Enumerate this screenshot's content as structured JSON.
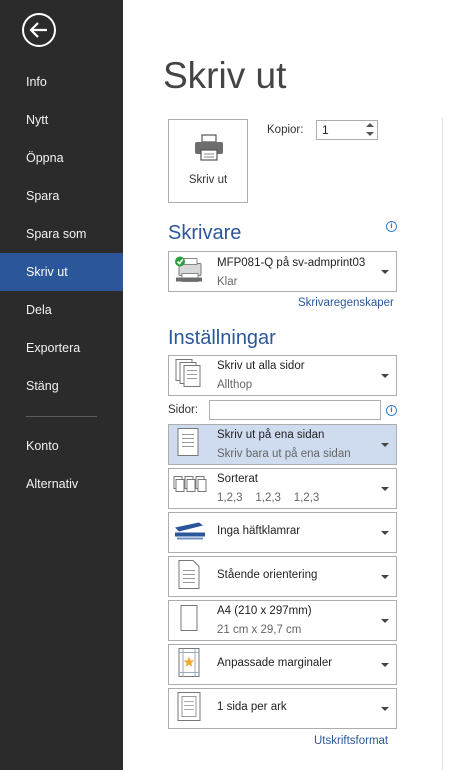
{
  "sidebar": {
    "items": [
      {
        "label": "Info"
      },
      {
        "label": "Nytt"
      },
      {
        "label": "Öppna"
      },
      {
        "label": "Spara"
      },
      {
        "label": "Spara som"
      },
      {
        "label": "Skriv ut",
        "active": true
      },
      {
        "label": "Dela"
      },
      {
        "label": "Exportera"
      },
      {
        "label": "Stäng"
      },
      {
        "label": "Konto"
      },
      {
        "label": "Alternativ"
      }
    ],
    "back_icon": "back-arrow-circle-icon"
  },
  "main": {
    "title": "Skriv ut",
    "print_button_label": "Skriv ut",
    "copies_label": "Kopior:",
    "copies_value": "1"
  },
  "printer": {
    "section_title": "Skrivare",
    "name": "MFP081-Q på sv-admprint03",
    "status": "Klar",
    "properties_link": "Skrivaregenskaper"
  },
  "settings": {
    "section_title": "Inställningar",
    "range": {
      "title": "Skriv ut alla sidor",
      "subtitle": "Allthop"
    },
    "pages_label": "Sidor:",
    "pages_value": "",
    "sides": {
      "title": "Skriv ut på ena sidan",
      "subtitle": "Skriv bara ut på ena sidan"
    },
    "collate": {
      "title": "Sorterat",
      "subtitle": "1,2,3    1,2,3    1,2,3"
    },
    "staple": {
      "title": "Inga häftklamrar"
    },
    "orientation": {
      "title": "Stående orientering"
    },
    "paper": {
      "title": "A4 (210 x 297mm)",
      "subtitle": "21 cm x 29,7 cm"
    },
    "margins": {
      "title": "Anpassade marginaler"
    },
    "per_sheet": {
      "title": "1 sida per ark"
    },
    "page_setup_link": "Utskriftsformat"
  },
  "colors": {
    "sidebar_bg": "#2b2b2b",
    "accent": "#2b579a",
    "selected_bg": "#cfdcef"
  }
}
